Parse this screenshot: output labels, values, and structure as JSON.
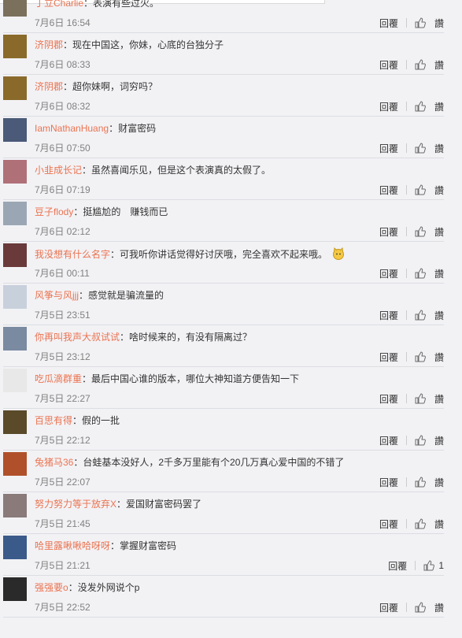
{
  "actions": {
    "reply": "回覆",
    "report": "讚"
  },
  "comments": [
    {
      "user": "丁立Charlie",
      "text": "表演有些过火。",
      "time": "7月6日 16:54",
      "likes": "",
      "avatar": "#7a705c"
    },
    {
      "user": "济阴郡",
      "text": "现在中国这，你妹，心底的台独分子",
      "time": "7月6日 08:33",
      "likes": "",
      "avatar": "#8a6a2a"
    },
    {
      "user": "济阴郡",
      "text": "超你妹啊，词穷吗？",
      "time": "7月6日 08:32",
      "likes": "",
      "avatar": "#8a6a2a"
    },
    {
      "user": "IamNathanHuang",
      "text": "财富密码",
      "time": "7月6日 07:50",
      "likes": "",
      "avatar": "#4a5a78"
    },
    {
      "user": "小韭成长记",
      "text": "虽然喜闻乐见，但是这个表演真的太假了。",
      "time": "7月6日 07:19",
      "likes": "",
      "avatar": "#b07078"
    },
    {
      "user": "豆子flody",
      "text": "挺尴尬的　赚钱而已",
      "time": "7月6日 02:12",
      "likes": "",
      "avatar": "#9aa6b4"
    },
    {
      "user": "我没想有什么名字",
      "text": "可我听你讲话觉得好讨厌哦，完全喜欢不起来哦。",
      "time": "7月6日 00:11",
      "likes": "",
      "avatar": "#6a3a3a"
    },
    {
      "user": "风筝与风jjj",
      "text": "感觉就是骗流量的",
      "time": "7月5日 23:51",
      "likes": "",
      "avatar": "#c8d0dc"
    },
    {
      "user": "你再叫我声大叔试试",
      "text": "啥时候来的，有没有隔离过？",
      "time": "7月5日 23:12",
      "likes": "",
      "avatar": "#7a8aa0"
    },
    {
      "user": "吃瓜滴群重",
      "text": "最后中国心谁的版本，哪位大神知道方便告知一下",
      "time": "7月5日 22:27",
      "likes": "",
      "avatar": "#e8e8e8"
    },
    {
      "user": "百思有得",
      "text": "假的一批",
      "time": "7月5日 22:12",
      "likes": "",
      "avatar": "#5a4a2a"
    },
    {
      "user": "兔猪马36",
      "text": "台蛙基本没好人，2千多万里能有个20几万真心爱中国的不错了",
      "time": "7月5日 22:07",
      "likes": "",
      "avatar": "#b0502a"
    },
    {
      "user": "努力努力等于放弃X",
      "text": "爱国财富密码罢了",
      "time": "7月5日 21:45",
      "likes": "",
      "avatar": "#8a7a7a"
    },
    {
      "user": "哈里露啾啾哈呀呀",
      "text": "掌握财富密码",
      "time": "7月5日 21:21",
      "likes": "1",
      "avatar": "#3a5a8a"
    },
    {
      "user": "强强要o",
      "text": "没发外网说个p",
      "time": "7月5日 22:52",
      "likes": "",
      "avatar": "#2a2a2a"
    }
  ]
}
